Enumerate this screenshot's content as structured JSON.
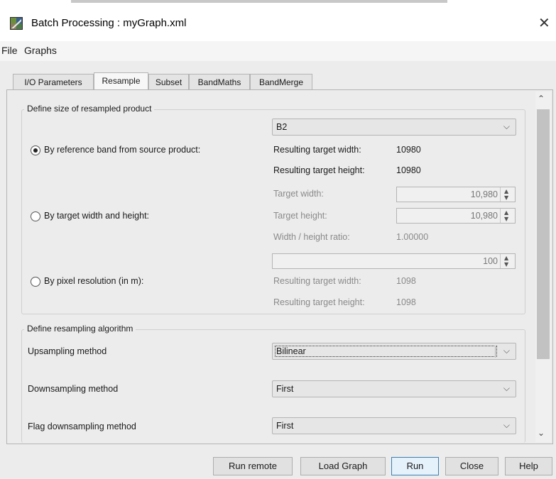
{
  "window": {
    "title": "Batch Processing : myGraph.xml",
    "close_glyph": "✕"
  },
  "menu": {
    "items": [
      "File",
      "Graphs"
    ]
  },
  "tabs": [
    "I/O Parameters",
    "Resample",
    "Subset",
    "BandMaths",
    "BandMerge"
  ],
  "active_tab": "Resample",
  "size_group": {
    "title": "Define size of resampled product",
    "reference_band": {
      "selected": "B2"
    },
    "option_reference": {
      "label": "By reference band from source product:",
      "selected": true,
      "result_width_label": "Resulting target width:",
      "result_width_value": "10980",
      "result_height_label": "Resulting target height:",
      "result_height_value": "10980"
    },
    "option_wh": {
      "label": "By target width and height:",
      "selected": false,
      "width_label": "Target width:",
      "width_value": "10,980",
      "height_label": "Target height:",
      "height_value": "10,980",
      "ratio_label": "Width / height ratio:",
      "ratio_value": "1.00000"
    },
    "option_pixel": {
      "label": "By pixel resolution (in m):",
      "selected": false,
      "resolution_value": "100",
      "result_width_label": "Resulting target width:",
      "result_width_value": "1098",
      "result_height_label": "Resulting target height:",
      "result_height_value": "1098"
    }
  },
  "algorithm_group": {
    "title": "Define resampling algorithm",
    "upsampling": {
      "label": "Upsampling method",
      "value": "Bilinear"
    },
    "downsampling": {
      "label": "Downsampling method",
      "value": "First"
    },
    "flag_downsampling": {
      "label": "Flag downsampling method",
      "value": "First"
    }
  },
  "buttons": {
    "run_remote": "Run remote",
    "load_graph": "Load Graph",
    "run": "Run",
    "close": "Close",
    "help": "Help"
  },
  "icons": {
    "chevron": "⌵",
    "spin_up": "▲",
    "spin_down": "▼",
    "scroll_up": "⌃",
    "scroll_down": "⌄"
  },
  "colors": {
    "accent": "#3c7fb1",
    "panel": "#ececec"
  }
}
